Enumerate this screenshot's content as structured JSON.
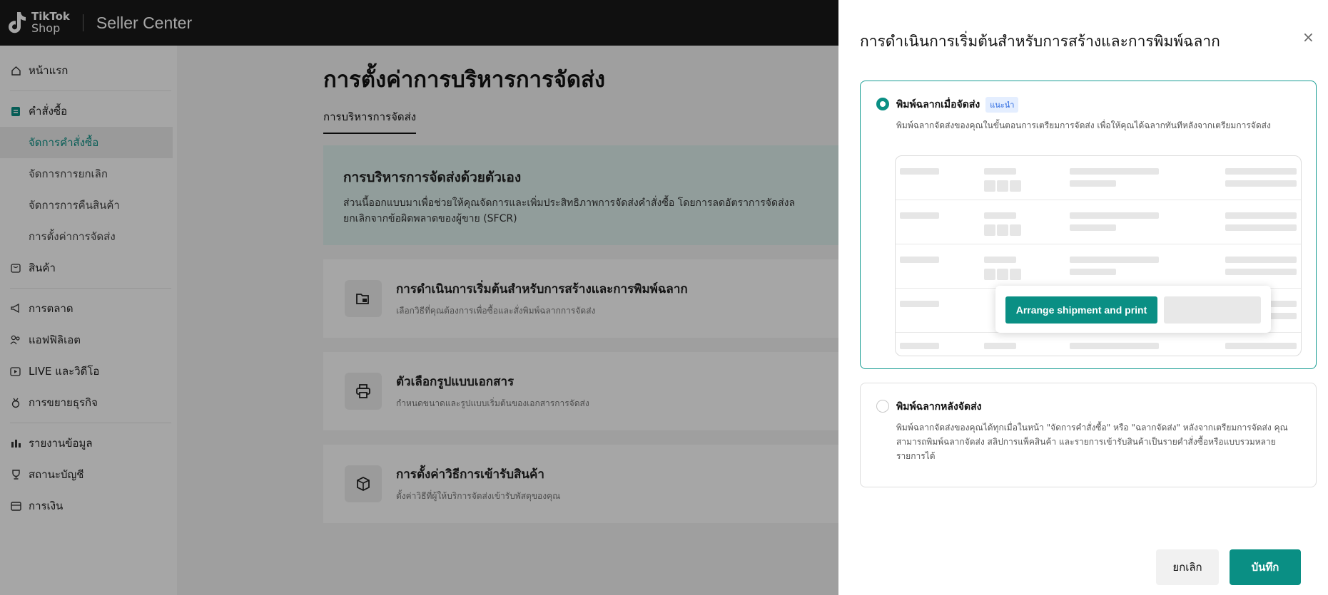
{
  "topbar": {
    "logo_line1": "TikTok",
    "logo_line2": "Shop",
    "brand": "Seller Center"
  },
  "sidebar": {
    "home": "หน้าแรก",
    "orders": "คำสั่งซื้อ",
    "order_subitems": [
      "จัดการคำสั่งซื้อ",
      "จัดการการยกเลิก",
      "จัดการการคืนสินค้า",
      "การตั้งค่าการจัดส่ง"
    ],
    "products": "สินค้า",
    "marketing": "การตลาด",
    "affiliate": "แอฟฟิลิเอต",
    "live_video": "LIVE และวิดีโอ",
    "growth": "การขยายธุรกิจ",
    "reports": "รายงานข้อมูล",
    "account_health": "สถานะบัญชี",
    "finance": "การเงิน"
  },
  "main": {
    "title": "การตั้งค่าการบริหารการจัดส่ง",
    "tab": "การบริหารการจัดส่ง",
    "banner_title": "การบริหารการจัดส่งด้วยตัวเอง",
    "banner_text_1": "ส่วนนี้ออกแบบมาเพื่อช่วยให้คุณจัดการและเพิ่มประสิทธิภาพการจัดส่งคำสั่งซื้อ โดยการลดอัตราการจัดส่งล",
    "banner_text_2": "ยกเลิกจากข้อผิดพลาดของผู้ขาย (SFCR)",
    "cards": [
      {
        "title": "การดำเนินการเริ่มต้นสำหรับการสร้างและการพิมพ์ฉลาก",
        "desc": "เลือกวิธีที่คุณต้องการเพื่อซื้อและสั่งพิมพ์ฉลากการจัดส่ง"
      },
      {
        "title": "ตัวเลือกรูปแบบเอกสาร",
        "desc": "กำหนดขนาดและรูปแบบเริ่มต้นของเอกสารการจัดส่ง"
      },
      {
        "title": "การตั้งค่าวิธีการเข้ารับสินค้า",
        "desc": "ตั้งค่าวิธีที่ผู้ให้บริการจัดส่งเข้ารับพัสดุของคุณ"
      }
    ]
  },
  "drawer": {
    "title": "การดำเนินการเริ่มต้นสำหรับการสร้างและการพิมพ์ฉลาก",
    "close": "×",
    "option1": {
      "title": "พิมพ์ฉลากเมื่อจัดส่ง",
      "badge": "แนะนำ",
      "desc": "พิมพ์ฉลากจัดส่งของคุณในขั้นตอนการเตรียมการจัดส่ง เพื่อให้คุณได้ฉลากทันทีหลังจากเตรียมการจัดส่ง",
      "preview_button": "Arrange shipment and print",
      "selected": true
    },
    "option2": {
      "title": "พิมพ์ฉลากหลังจัดส่ง",
      "desc": "พิมพ์ฉลากจัดส่งของคุณได้ทุกเมื่อในหน้า \"จัดการคำสั่งซื้อ\" หรือ \"ฉลากจัดส่ง\" หลังจากเตรียมการจัดส่ง คุณสามารถพิมพ์ฉลากจัดส่ง สลิปการแพ็คสินค้า และรายการเข้ารับสินค้าเป็นรายคำสั่งซื้อหรือแบบรวมหลายรายการได้",
      "selected": false
    },
    "cancel": "ยกเลิก",
    "save": "บันทึก"
  },
  "colors": {
    "accent": "#0a8f84",
    "topbar": "#191919",
    "banner": "#dff1ef"
  }
}
